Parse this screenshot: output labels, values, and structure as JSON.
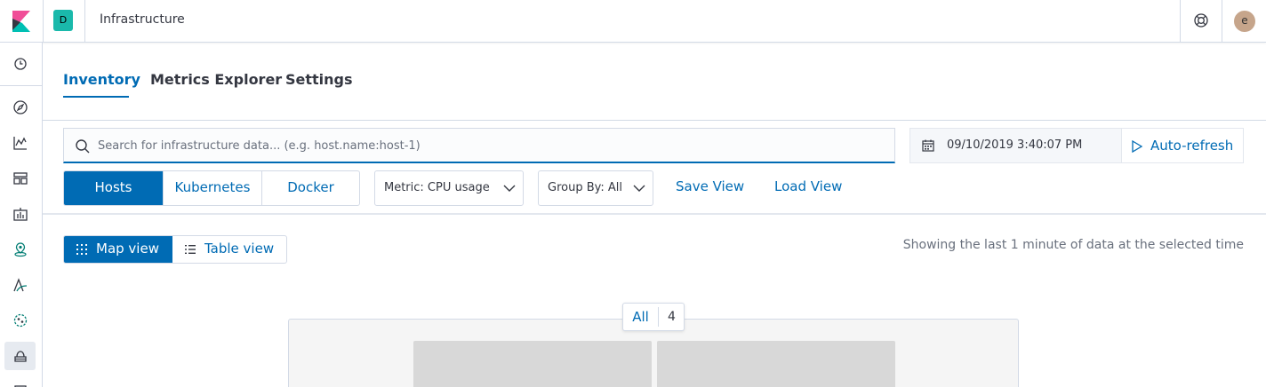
{
  "header": {
    "space_initial": "D",
    "app_title": "Infrastructure",
    "avatar_initial": "e",
    "space_color": "#1ab9ab"
  },
  "sidenav": {
    "items": [
      {
        "icon": "clock-icon",
        "label": "Recently viewed"
      },
      {
        "icon": "compass-icon",
        "label": "Discover"
      },
      {
        "icon": "visualize-icon",
        "label": "Visualize"
      },
      {
        "icon": "dashboard-icon",
        "label": "Dashboard"
      },
      {
        "icon": "canvas-icon",
        "label": "Canvas"
      },
      {
        "icon": "maps-icon",
        "label": "Maps"
      },
      {
        "icon": "apm-icon",
        "label": "APM"
      },
      {
        "icon": "ml-icon",
        "label": "Machine Learning"
      },
      {
        "icon": "infrastructure-icon",
        "label": "Infrastructure",
        "active": true
      }
    ]
  },
  "tabs": [
    {
      "label": "Inventory",
      "active": true
    },
    {
      "label": "Metrics Explorer",
      "active": false
    },
    {
      "label": "Settings",
      "active": false
    }
  ],
  "search": {
    "placeholder": "Search for infrastructure data... (e.g. host.name:host-1)",
    "value": ""
  },
  "datepicker": {
    "value": "09/10/2019 3:40:07 PM",
    "auto_refresh_label": "Auto-refresh"
  },
  "toolbar": {
    "node_types": [
      {
        "label": "Hosts",
        "selected": true
      },
      {
        "label": "Kubernetes",
        "selected": false
      },
      {
        "label": "Docker",
        "selected": false
      }
    ],
    "metric_label": "Metric: CPU usage",
    "group_by_label": "Group By: All",
    "save_view_label": "Save View",
    "load_view_label": "Load View"
  },
  "view_toggle": {
    "map_label": "Map view",
    "table_label": "Table view",
    "selected": "map"
  },
  "status_text": "Showing the last 1 minute of data at the selected time",
  "map": {
    "group_name": "All",
    "group_count": "4"
  },
  "colors": {
    "accent": "#006bb4",
    "text": "#343741",
    "subdued": "#69707d",
    "border": "#d3dae6"
  }
}
